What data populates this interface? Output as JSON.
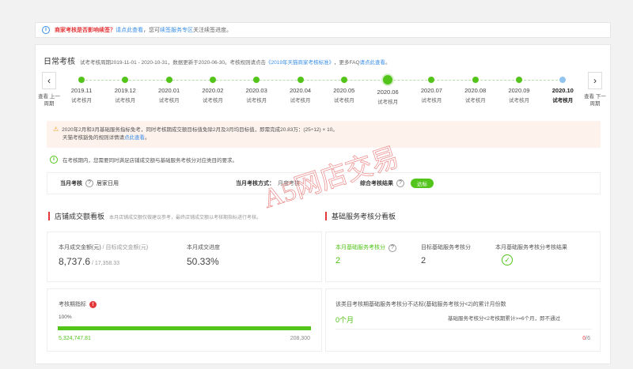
{
  "notice": {
    "q": "商家考核是否影响续签？",
    "link1": "请点此查看",
    "mid": "，您可",
    "link2": "续签服务专区",
    "tail": "关注续签进度。"
  },
  "header": {
    "title": "日常考核",
    "desc_prefix": "试考考核周期2019-11-01 - 2020-10-31，数据更新于2020-06-30。考核规则请点击",
    "rule_link": "《2019年天猫商家考核标准》",
    "faq_prefix": "，更多FAQ",
    "faq_link": "请点此查看",
    "faq_end": "。"
  },
  "nav": {
    "prev_label": "查看 上一周期",
    "next_label": "查看 下一周期",
    "prev_icon": "chevron-left-icon",
    "next_icon": "chevron-right-icon"
  },
  "timeline": [
    {
      "date": "2019.11",
      "sub": "试考核月"
    },
    {
      "date": "2019.12",
      "sub": "试考核月"
    },
    {
      "date": "2020.01",
      "sub": "试考核月"
    },
    {
      "date": "2020.02",
      "sub": "试考核月"
    },
    {
      "date": "2020.03",
      "sub": "试考核月"
    },
    {
      "date": "2020.04",
      "sub": "试考核月"
    },
    {
      "date": "2020.05",
      "sub": "试考核月"
    },
    {
      "date": "2020.06",
      "sub": "试考核月"
    },
    {
      "date": "2020.07",
      "sub": "试考核月"
    },
    {
      "date": "2020.08",
      "sub": "试考核月"
    },
    {
      "date": "2020.09",
      "sub": "试考核月"
    },
    {
      "date": "2020.10",
      "sub": "试考核月"
    }
  ],
  "warning": {
    "line1": "2020年2月和3月基础服务指标免考，同时考核期成交额目标值免除2月及3月均目标值，即需完成20.83万：(25÷12) × 10。",
    "line2_prefix": "天猫考核豁免的规则详情请",
    "line2_link": "点此查看",
    "line2_end": "。"
  },
  "info2": "在考核期内，您需要同时满足店铺成交额与基础服务考核分对应类目的要求。",
  "row": {
    "current_label": "当月考核",
    "current_value": "居家日用",
    "method_label": "当月考核方式：",
    "method_value": "月度考核",
    "result_label": "综合考核结果",
    "result_badge": "达标"
  },
  "left_section": {
    "title": "店铺成交额看板",
    "desc": "本月店铺成交额仅做建议参考，最终店铺成交额以考核期指标进行考核。",
    "amount_label": "本月成交金额(元)",
    "target_label": " / 目标成交金额(元)",
    "amount_value": "8,737.6",
    "target_value": "17,358.33",
    "progress_label": "本月成交进度",
    "progress_value": "50.33%",
    "period_label": "考核期指标",
    "period_pct": "100%",
    "progress_fraction": 1.0,
    "period_done": "5,324,747.81",
    "period_target": "208,300"
  },
  "right_section": {
    "title": "基础服务考核分看板",
    "score_label": "本月基础服务考核分",
    "score_value": "2",
    "target_label": "目标基础服务考核分",
    "target_value": "2",
    "result_label": "本月基础服务考核分考核结果",
    "fail_desc": "该类目考核期基础服务考核分不达标(基础服务考核分<2)的累计月份数",
    "fail_count": "0个月",
    "rule_text": "基础服务考核分<2考核期累计>=6个月，即不通过",
    "fraction_num": "0",
    "fraction_den": "/6"
  },
  "watermark": "A5网店交易",
  "colors": {
    "accent_green": "#52c41a",
    "alert_red": "#e4393c",
    "link_blue": "#3a8ee6"
  }
}
